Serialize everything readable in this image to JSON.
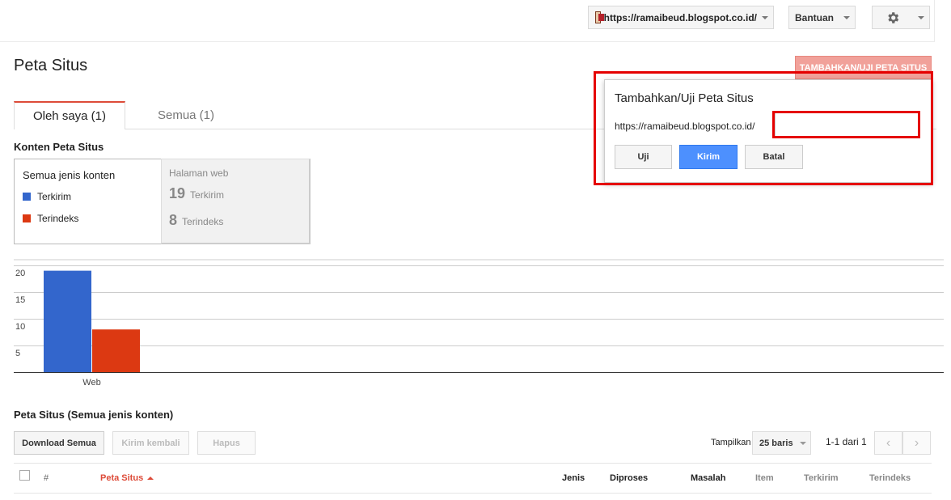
{
  "topbar": {
    "site_url": "https://ramaibeud.blogspot.co.id/",
    "help_label": "Bantuan"
  },
  "page": {
    "title": "Peta Situs",
    "add_button": "TAMBAHKAN/UJI PETA SITUS"
  },
  "tabs": [
    {
      "label": "Oleh saya (1)",
      "active": true
    },
    {
      "label": "Semua (1)",
      "active": false
    }
  ],
  "content_section": {
    "label": "Konten Peta Situs",
    "all_types": "Semua jenis konten",
    "legend": [
      {
        "label": "Terkirim",
        "color": "#3366cc"
      },
      {
        "label": "Terindeks",
        "color": "#dc3912"
      }
    ],
    "web": {
      "title": "Halaman web",
      "submitted_count": "19",
      "submitted_label": "Terkirim",
      "indexed_count": "8",
      "indexed_label": "Terindeks"
    }
  },
  "chart_data": {
    "type": "bar",
    "categories": [
      "Web"
    ],
    "series": [
      {
        "name": "Terkirim",
        "values": [
          19
        ],
        "color": "#3366cc"
      },
      {
        "name": "Terindeks",
        "values": [
          8
        ],
        "color": "#dc3912"
      }
    ],
    "yticks": [
      5,
      10,
      15,
      20
    ],
    "ylim": [
      0,
      20
    ],
    "grid": true
  },
  "sitemap_list": {
    "title": "Peta Situs (Semua jenis konten)",
    "download_all": "Download Semua",
    "resubmit": "Kirim kembali",
    "delete": "Hapus",
    "show_label": "Tampilkan",
    "rows_option": "25 baris",
    "pager_text": "1-1 dari 1",
    "columns": {
      "hash": "#",
      "sitemap": "Peta Situs",
      "type": "Jenis",
      "processed": "Diproses",
      "issues": "Masalah",
      "items": "Item",
      "submitted": "Terkirim",
      "indexed": "Terindeks"
    }
  },
  "dialog": {
    "title": "Tambahkan/Uji Peta Situs",
    "url_prefix": "https://ramaibeud.blogspot.co.id/",
    "input_value": "",
    "test_button": "Uji",
    "submit_button": "Kirim",
    "cancel_button": "Batal"
  }
}
